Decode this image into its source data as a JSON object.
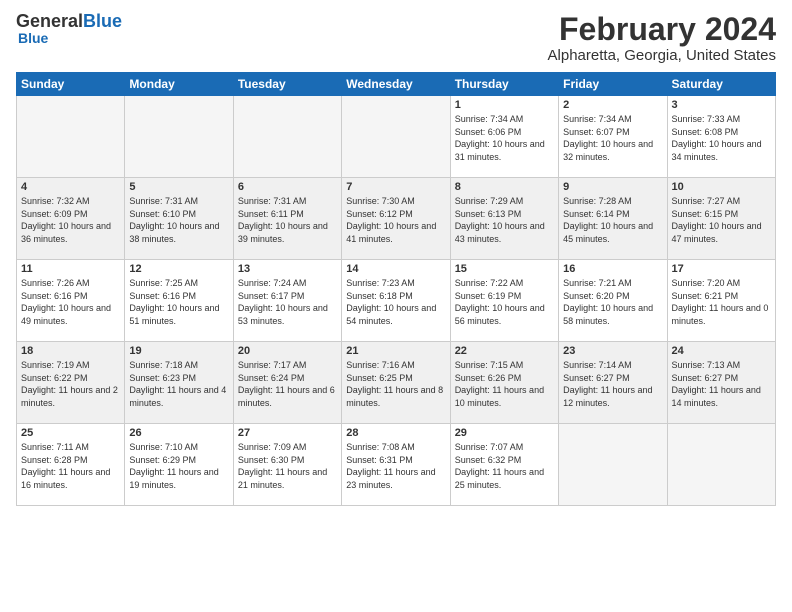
{
  "logo": {
    "general": "General",
    "blue": "Blue"
  },
  "title": "February 2024",
  "subtitle": "Alpharetta, Georgia, United States",
  "days_of_week": [
    "Sunday",
    "Monday",
    "Tuesday",
    "Wednesday",
    "Thursday",
    "Friday",
    "Saturday"
  ],
  "weeks": [
    [
      {
        "day": "",
        "sunrise": "",
        "sunset": "",
        "daylight": "",
        "empty": true
      },
      {
        "day": "",
        "sunrise": "",
        "sunset": "",
        "daylight": "",
        "empty": true
      },
      {
        "day": "",
        "sunrise": "",
        "sunset": "",
        "daylight": "",
        "empty": true
      },
      {
        "day": "",
        "sunrise": "",
        "sunset": "",
        "daylight": "",
        "empty": true
      },
      {
        "day": "1",
        "sunrise": "Sunrise: 7:34 AM",
        "sunset": "Sunset: 6:06 PM",
        "daylight": "Daylight: 10 hours and 31 minutes."
      },
      {
        "day": "2",
        "sunrise": "Sunrise: 7:34 AM",
        "sunset": "Sunset: 6:07 PM",
        "daylight": "Daylight: 10 hours and 32 minutes."
      },
      {
        "day": "3",
        "sunrise": "Sunrise: 7:33 AM",
        "sunset": "Sunset: 6:08 PM",
        "daylight": "Daylight: 10 hours and 34 minutes."
      }
    ],
    [
      {
        "day": "4",
        "sunrise": "Sunrise: 7:32 AM",
        "sunset": "Sunset: 6:09 PM",
        "daylight": "Daylight: 10 hours and 36 minutes."
      },
      {
        "day": "5",
        "sunrise": "Sunrise: 7:31 AM",
        "sunset": "Sunset: 6:10 PM",
        "daylight": "Daylight: 10 hours and 38 minutes."
      },
      {
        "day": "6",
        "sunrise": "Sunrise: 7:31 AM",
        "sunset": "Sunset: 6:11 PM",
        "daylight": "Daylight: 10 hours and 39 minutes."
      },
      {
        "day": "7",
        "sunrise": "Sunrise: 7:30 AM",
        "sunset": "Sunset: 6:12 PM",
        "daylight": "Daylight: 10 hours and 41 minutes."
      },
      {
        "day": "8",
        "sunrise": "Sunrise: 7:29 AM",
        "sunset": "Sunset: 6:13 PM",
        "daylight": "Daylight: 10 hours and 43 minutes."
      },
      {
        "day": "9",
        "sunrise": "Sunrise: 7:28 AM",
        "sunset": "Sunset: 6:14 PM",
        "daylight": "Daylight: 10 hours and 45 minutes."
      },
      {
        "day": "10",
        "sunrise": "Sunrise: 7:27 AM",
        "sunset": "Sunset: 6:15 PM",
        "daylight": "Daylight: 10 hours and 47 minutes."
      }
    ],
    [
      {
        "day": "11",
        "sunrise": "Sunrise: 7:26 AM",
        "sunset": "Sunset: 6:16 PM",
        "daylight": "Daylight: 10 hours and 49 minutes."
      },
      {
        "day": "12",
        "sunrise": "Sunrise: 7:25 AM",
        "sunset": "Sunset: 6:16 PM",
        "daylight": "Daylight: 10 hours and 51 minutes."
      },
      {
        "day": "13",
        "sunrise": "Sunrise: 7:24 AM",
        "sunset": "Sunset: 6:17 PM",
        "daylight": "Daylight: 10 hours and 53 minutes."
      },
      {
        "day": "14",
        "sunrise": "Sunrise: 7:23 AM",
        "sunset": "Sunset: 6:18 PM",
        "daylight": "Daylight: 10 hours and 54 minutes."
      },
      {
        "day": "15",
        "sunrise": "Sunrise: 7:22 AM",
        "sunset": "Sunset: 6:19 PM",
        "daylight": "Daylight: 10 hours and 56 minutes."
      },
      {
        "day": "16",
        "sunrise": "Sunrise: 7:21 AM",
        "sunset": "Sunset: 6:20 PM",
        "daylight": "Daylight: 10 hours and 58 minutes."
      },
      {
        "day": "17",
        "sunrise": "Sunrise: 7:20 AM",
        "sunset": "Sunset: 6:21 PM",
        "daylight": "Daylight: 11 hours and 0 minutes."
      }
    ],
    [
      {
        "day": "18",
        "sunrise": "Sunrise: 7:19 AM",
        "sunset": "Sunset: 6:22 PM",
        "daylight": "Daylight: 11 hours and 2 minutes."
      },
      {
        "day": "19",
        "sunrise": "Sunrise: 7:18 AM",
        "sunset": "Sunset: 6:23 PM",
        "daylight": "Daylight: 11 hours and 4 minutes."
      },
      {
        "day": "20",
        "sunrise": "Sunrise: 7:17 AM",
        "sunset": "Sunset: 6:24 PM",
        "daylight": "Daylight: 11 hours and 6 minutes."
      },
      {
        "day": "21",
        "sunrise": "Sunrise: 7:16 AM",
        "sunset": "Sunset: 6:25 PM",
        "daylight": "Daylight: 11 hours and 8 minutes."
      },
      {
        "day": "22",
        "sunrise": "Sunrise: 7:15 AM",
        "sunset": "Sunset: 6:26 PM",
        "daylight": "Daylight: 11 hours and 10 minutes."
      },
      {
        "day": "23",
        "sunrise": "Sunrise: 7:14 AM",
        "sunset": "Sunset: 6:27 PM",
        "daylight": "Daylight: 11 hours and 12 minutes."
      },
      {
        "day": "24",
        "sunrise": "Sunrise: 7:13 AM",
        "sunset": "Sunset: 6:27 PM",
        "daylight": "Daylight: 11 hours and 14 minutes."
      }
    ],
    [
      {
        "day": "25",
        "sunrise": "Sunrise: 7:11 AM",
        "sunset": "Sunset: 6:28 PM",
        "daylight": "Daylight: 11 hours and 16 minutes."
      },
      {
        "day": "26",
        "sunrise": "Sunrise: 7:10 AM",
        "sunset": "Sunset: 6:29 PM",
        "daylight": "Daylight: 11 hours and 19 minutes."
      },
      {
        "day": "27",
        "sunrise": "Sunrise: 7:09 AM",
        "sunset": "Sunset: 6:30 PM",
        "daylight": "Daylight: 11 hours and 21 minutes."
      },
      {
        "day": "28",
        "sunrise": "Sunrise: 7:08 AM",
        "sunset": "Sunset: 6:31 PM",
        "daylight": "Daylight: 11 hours and 23 minutes."
      },
      {
        "day": "29",
        "sunrise": "Sunrise: 7:07 AM",
        "sunset": "Sunset: 6:32 PM",
        "daylight": "Daylight: 11 hours and 25 minutes."
      },
      {
        "day": "",
        "sunrise": "",
        "sunset": "",
        "daylight": "",
        "empty": true
      },
      {
        "day": "",
        "sunrise": "",
        "sunset": "",
        "daylight": "",
        "empty": true
      }
    ]
  ]
}
